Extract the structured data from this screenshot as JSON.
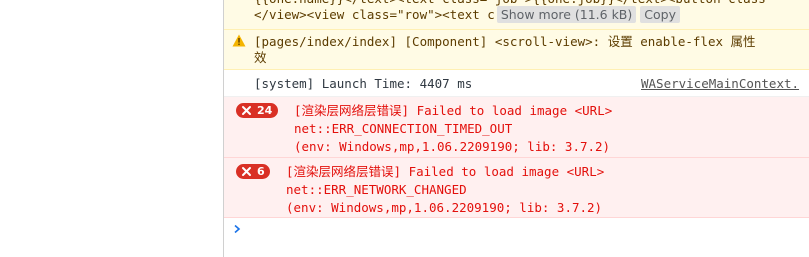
{
  "console": {
    "truncated_top_line": "{{one.name}}</text><text class=\"job\">{{one.job}}</text><button class",
    "view_row_line": "</view><view class=\"row\"><text c",
    "show_more_label": "Show more (11.6 kB)",
    "copy_label": "Copy",
    "warning": {
      "line1": "[pages/index/index] [Component] <scroll-view>: 设置 enable-flex 属性",
      "line2": "效",
      "icon": "warning-triangle-icon",
      "color": "#5c3c00"
    },
    "info": {
      "text": "[system] Launch Time: 4407 ms",
      "source": "WAServiceMainContext."
    },
    "errors": [
      {
        "count": "24",
        "line1": "[渲染层网络层错误] Failed to load image <URL>",
        "line2": "net::ERR_CONNECTION_TIMED_OUT",
        "line3": "(env: Windows,mp,1.06.2209190; lib: 3.7.2)"
      },
      {
        "count": "6",
        "line1": "[渲染层网络层错误] Failed to load image <URL>",
        "line2": "net::ERR_NETWORK_CHANGED",
        "line3": "(env: Windows,mp,1.06.2209190; lib: 3.7.2)"
      }
    ],
    "prompt": {
      "value": "",
      "icon": "chevron-right-icon"
    },
    "colors": {
      "error_text": "#e3100c",
      "error_bg": "#fff0f0",
      "badge_bg": "#d93025",
      "warning_bg": "#fffbe5",
      "prompt_accent": "#1a73e8"
    }
  }
}
